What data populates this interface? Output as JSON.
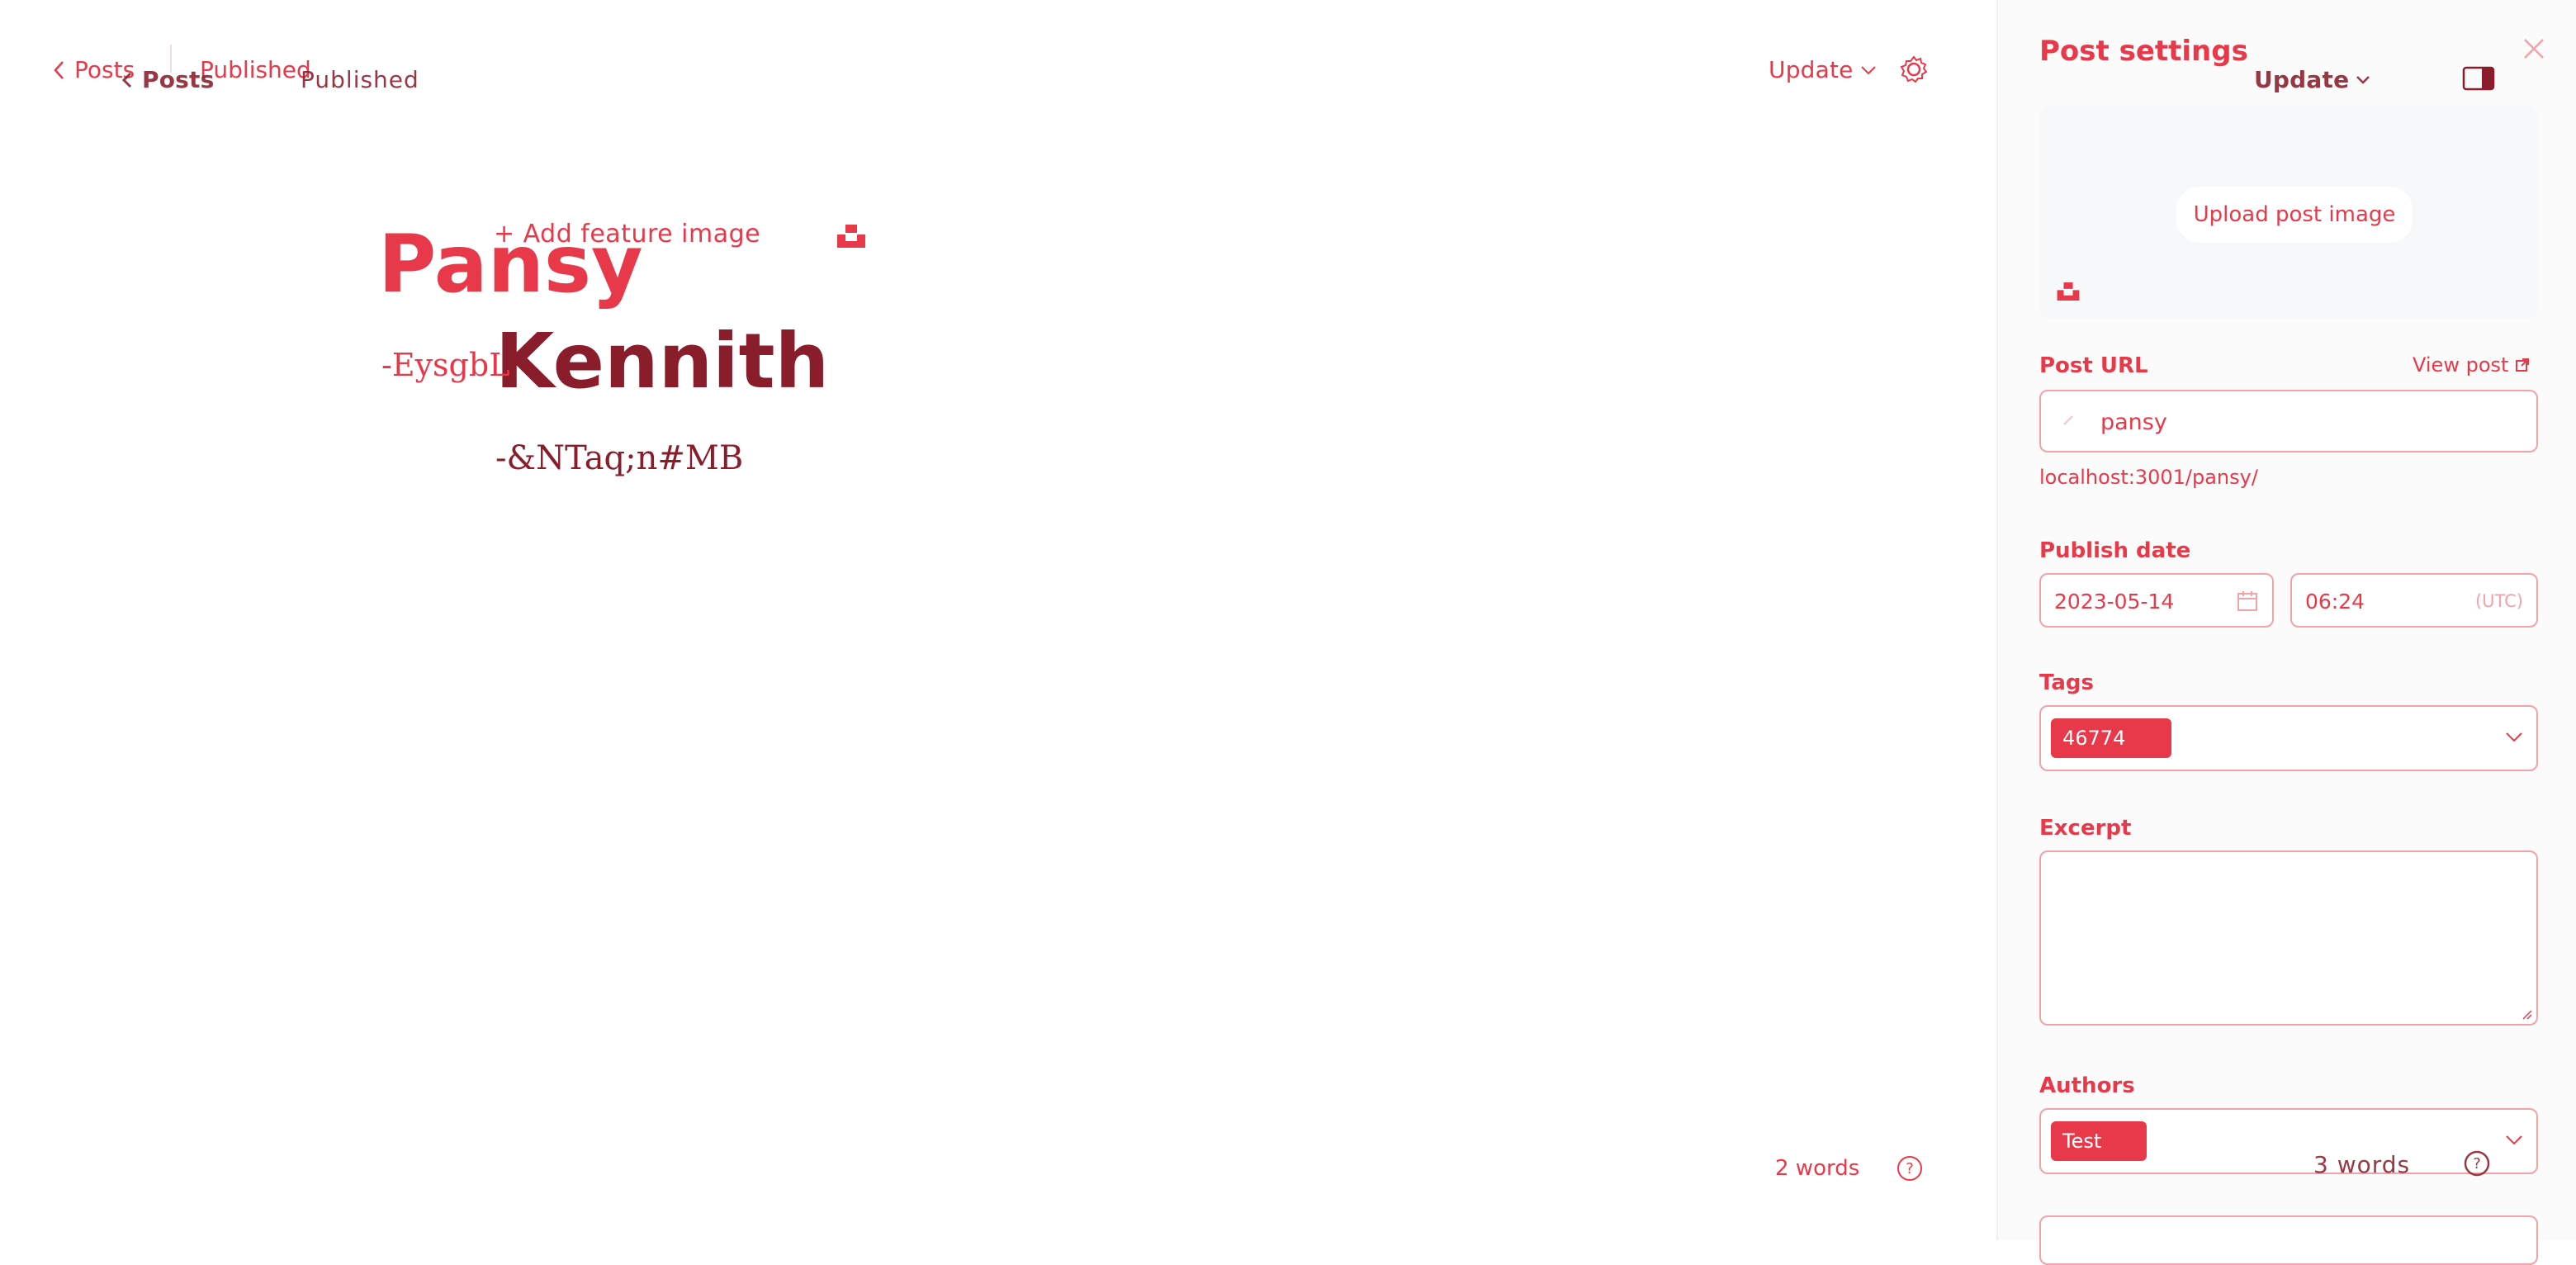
{
  "editor": {
    "breadcrumb": {
      "back_label": "Posts",
      "status": "Published"
    },
    "topbar": {
      "update_label": "Update"
    },
    "feature_image_label": "+ Add feature image",
    "title_lines": [
      "Pansy",
      "Kennith"
    ],
    "subtitle_1": "-EysgbL",
    "subtitle_2": "-&NTaq;n#MB",
    "word_count": "2 words",
    "word_count_2": "3 words"
  },
  "ghost_overlay": {
    "back_label": "Posts",
    "status": "Published",
    "update_label": "Update"
  },
  "panel": {
    "title": "Post settings",
    "upload_label": "Upload post image",
    "post_url_label": "Post URL",
    "view_post_label": "View post",
    "post_url_value": "pansy",
    "post_url_full": "localhost:3001/pansy/",
    "publish_date_label": "Publish date",
    "publish_date": "2023-05-14",
    "publish_time": "06:24",
    "timezone": "UTC",
    "tags_label": "Tags",
    "tag_chip": "46774",
    "excerpt_label": "Excerpt",
    "excerpt_value": "",
    "authors_label": "Authors",
    "author_chip": "Test"
  },
  "colors": {
    "accent": "#e8394a",
    "dark_accent": "#8a1d2b",
    "panel_bg": "#fbfbfc"
  },
  "icons": [
    "chevron-left-icon",
    "chevron-down-icon",
    "gear-icon",
    "close-icon",
    "sidebar-toggle-icon",
    "unsplash-icon",
    "external-link-icon",
    "calendar-icon",
    "help-icon"
  ]
}
